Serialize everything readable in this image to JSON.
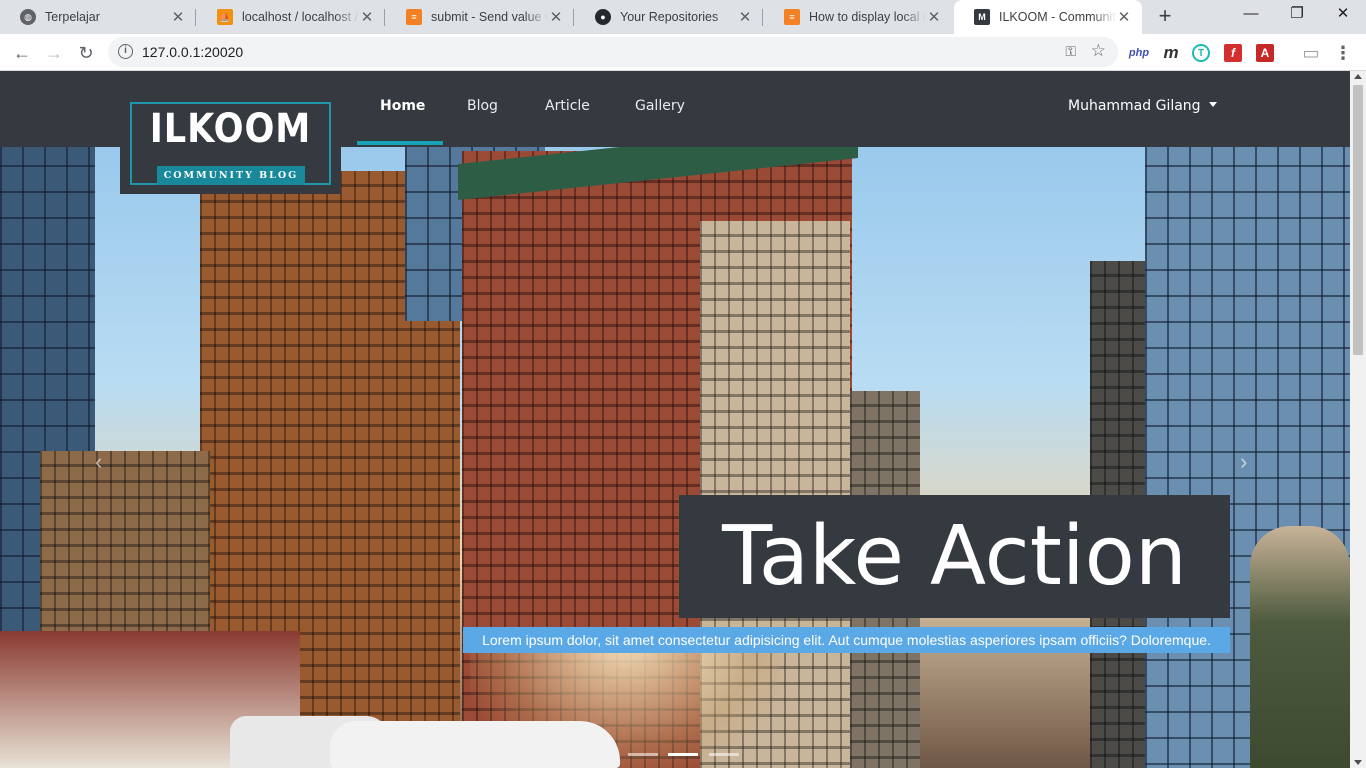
{
  "browser": {
    "tabs": [
      {
        "title": "Terpelajar",
        "icon": "globe-icon",
        "color": "#5f6368"
      },
      {
        "title": "localhost / localhost / re",
        "icon": "phpmyadmin-icon",
        "color": "#f29111"
      },
      {
        "title": "submit - Send value wit",
        "icon": "stackoverflow-icon",
        "color": "#f48024"
      },
      {
        "title": "Your Repositories",
        "icon": "github-icon",
        "color": "#24292e"
      },
      {
        "title": "How to display local im",
        "icon": "stackoverflow-icon",
        "color": "#f48024"
      },
      {
        "title": "ILKOOM - Community Bl",
        "icon": "site-m-icon",
        "color": "#343a40",
        "active": true
      }
    ],
    "new_tab": "+",
    "window_controls": {
      "minimize": "—",
      "maximize": "❐",
      "close": "✕"
    },
    "nav": {
      "back": "←",
      "forward": "→",
      "reload": "↻"
    },
    "url": "127.0.0.1:20020",
    "info_glyph": "i",
    "key_glyph": "⚿",
    "star_glyph": "☆",
    "extensions": [
      {
        "label": "php",
        "color": "#3f51b5"
      },
      {
        "label": "m",
        "color": "#333333"
      },
      {
        "label": "T",
        "color": "#1cbbb4"
      },
      {
        "label": "f",
        "color": "#d32f2f"
      },
      {
        "label": "A",
        "color": "#c62828"
      },
      {
        "label": "▭",
        "color": "#9e9e9e"
      },
      {
        "label": "⋮",
        "color": "#5f6368"
      }
    ]
  },
  "site": {
    "brand": {
      "name": "ILKOOM",
      "tagline": "COMMUNITY BLOG"
    },
    "nav": [
      {
        "label": "Home",
        "active": true
      },
      {
        "label": "Blog"
      },
      {
        "label": "Article"
      },
      {
        "label": "Gallery"
      }
    ],
    "user": "Muhammad Gilang",
    "hero": {
      "title": "Take Action",
      "text": "Lorem ipsum dolor, sit amet consectetur adipisicing elit. Aut cumque molestias asperiores ipsam officiis? Doloremque.",
      "prev_glyph": "‹",
      "next_glyph": "›",
      "slides": 3,
      "active_slide": 2
    },
    "colors": {
      "navbar": "#343a40",
      "accent": "#17a2b8",
      "caption_text_bg": "#5aa9e6"
    }
  }
}
